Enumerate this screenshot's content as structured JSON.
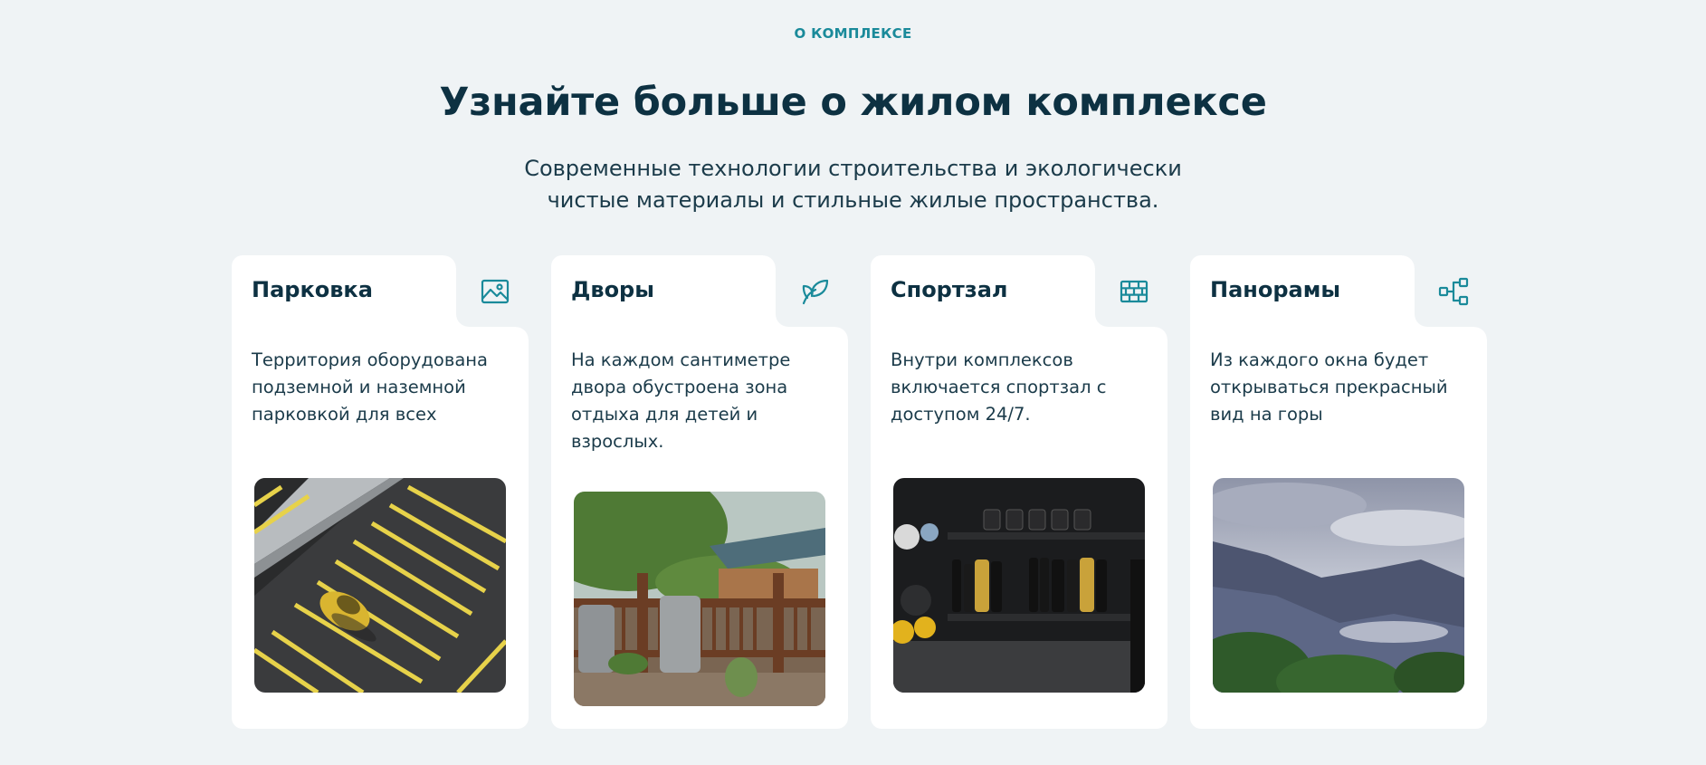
{
  "section": {
    "eyebrow": "О КОМПЛЕКСЕ",
    "title": "Узнайте больше о жилом комплексе",
    "subtitle": "Современные технологии строительства и экологически чистые материалы и стильные жилые пространства."
  },
  "colors": {
    "accent": "#1a8a9a",
    "heading": "#0d3142",
    "background": "#eff3f5",
    "card": "#ffffff"
  },
  "cards": [
    {
      "title": "Парковка",
      "text": "Территория оборудована подземной и наземной парковкой для всех",
      "icon": "image-icon",
      "image": "parking-lot-photo"
    },
    {
      "title": "Дворы",
      "text": "На каждом сантиметре двора обустроена зона отдыха для детей и взрослых.",
      "icon": "leaf-icon",
      "image": "courtyard-deck-photo"
    },
    {
      "title": "Спортзал",
      "text": "Внутри комплексов включается спортзал с доступом 24/7.",
      "icon": "brick-wall-icon",
      "image": "gym-weights-photo"
    },
    {
      "title": "Панорамы",
      "text": "Из каждого окна будет открываться прекрасный вид на горы",
      "icon": "network-icon",
      "image": "mountain-view-photo"
    }
  ]
}
